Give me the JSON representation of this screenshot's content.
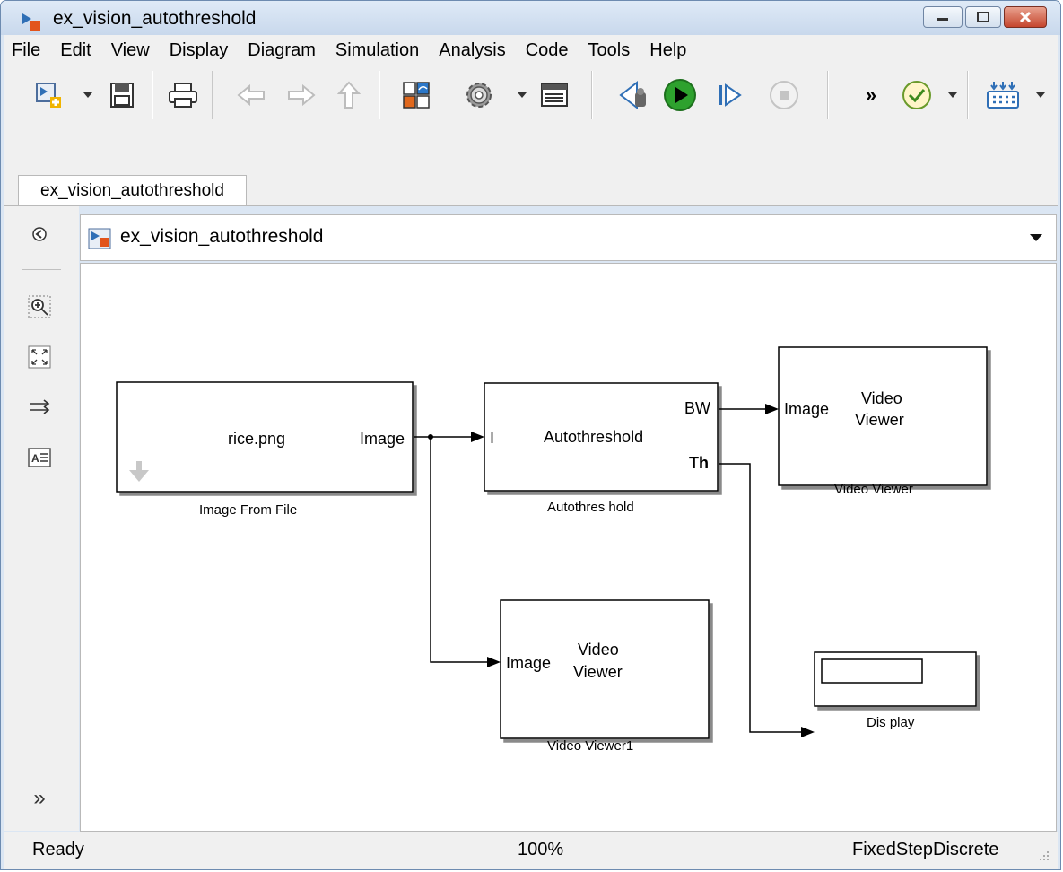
{
  "window": {
    "title": "ex_vision_autothreshold"
  },
  "menu": [
    "File",
    "Edit",
    "View",
    "Display",
    "Diagram",
    "Simulation",
    "Analysis",
    "Code",
    "Tools",
    "Help"
  ],
  "toolbar": {
    "icons": [
      "new-model-icon",
      "save-icon",
      "print-icon",
      "back-icon",
      "forward-icon",
      "up-icon",
      "library-browser-icon",
      "model-settings-icon",
      "model-explorer-icon",
      "step-back-icon",
      "run-icon",
      "step-forward-icon",
      "stop-icon",
      "more-icon",
      "model-advisor-icon",
      "build-icon"
    ],
    "more_label": "»"
  },
  "tabs": [
    {
      "label": "ex_vision_autothreshold"
    }
  ],
  "address": {
    "path": "ex_vision_autothreshold"
  },
  "leftbar": {
    "expand_label": "»"
  },
  "diagram": {
    "blocks": {
      "image_from_file": {
        "content": "rice.png",
        "port_out": "Image",
        "name": "Image From File"
      },
      "autothreshold": {
        "content": "Autothreshold",
        "port_in": "I",
        "port_out_1": "BW",
        "port_out_2": "Th",
        "name": "Autothres hold"
      },
      "video_viewer": {
        "port_in": "Image",
        "content_line1": "Video",
        "content_line2": "Viewer",
        "name": "Video Viewer"
      },
      "video_viewer1": {
        "port_in": "Image",
        "content_line1": "Video",
        "content_line2": "Viewer",
        "name": "Video Viewer1"
      },
      "display": {
        "name": "Dis play"
      }
    }
  },
  "status": {
    "state": "Ready",
    "zoom": "100%",
    "solver": "FixedStepDiscrete"
  },
  "colors": {
    "run_green": "#2ea12e",
    "title_bg": "#dbe6f3",
    "close_red": "#c5462e"
  }
}
